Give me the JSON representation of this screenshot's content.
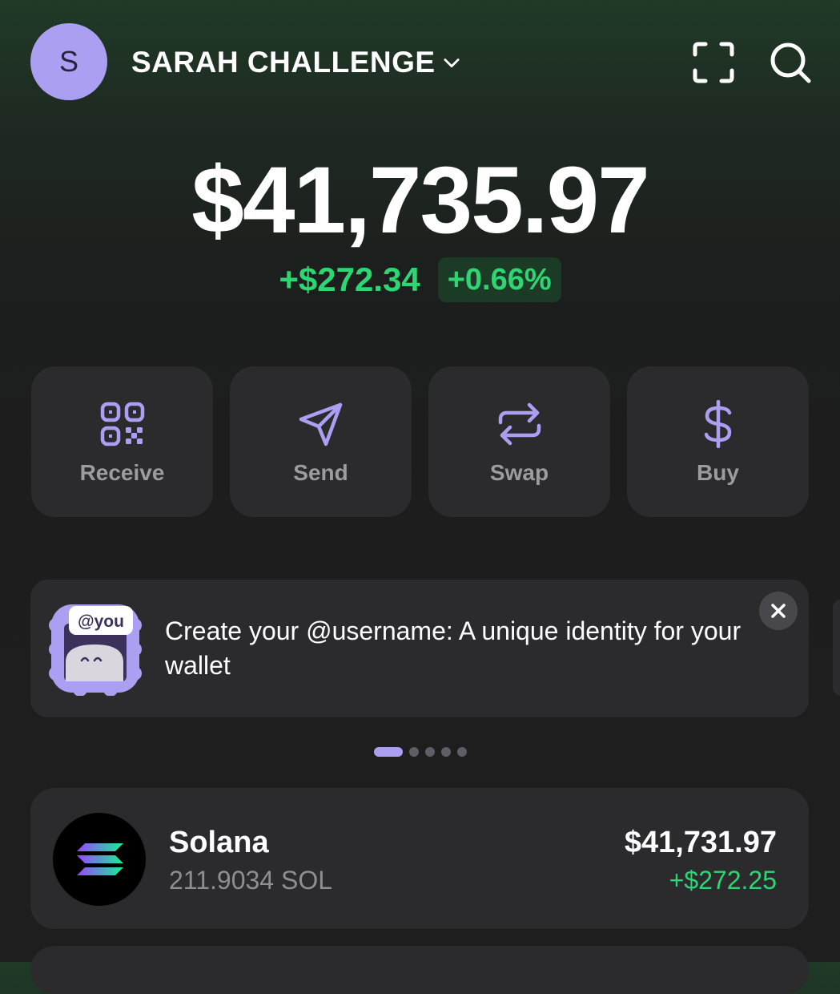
{
  "account": {
    "initial": "S",
    "name": "SARAH CHALLENGE"
  },
  "header_icons": [
    "scan-icon",
    "search-icon"
  ],
  "balance": {
    "total": "$41,735.97",
    "change_amount": "+$272.34",
    "change_percent": "+0.66%"
  },
  "actions": [
    {
      "label": "Receive",
      "icon": "qr-code-icon"
    },
    {
      "label": "Send",
      "icon": "paper-plane-icon"
    },
    {
      "label": "Swap",
      "icon": "swap-arrows-icon"
    },
    {
      "label": "Buy",
      "icon": "dollar-icon"
    }
  ],
  "banner": {
    "badge": "@you",
    "text": "Create your @username: A unique identity for your wallet"
  },
  "carousel": {
    "count": 5,
    "active": 0
  },
  "tokens": [
    {
      "name": "Solana",
      "quantity": "211.9034 SOL",
      "value": "$41,731.97",
      "change": "+$272.25",
      "icon": "solana-logo-icon"
    }
  ],
  "colors": {
    "accent": "#ab9ff2",
    "positive": "#2ed573",
    "card": "#2b2b2e",
    "background": "#1e1e1f"
  }
}
